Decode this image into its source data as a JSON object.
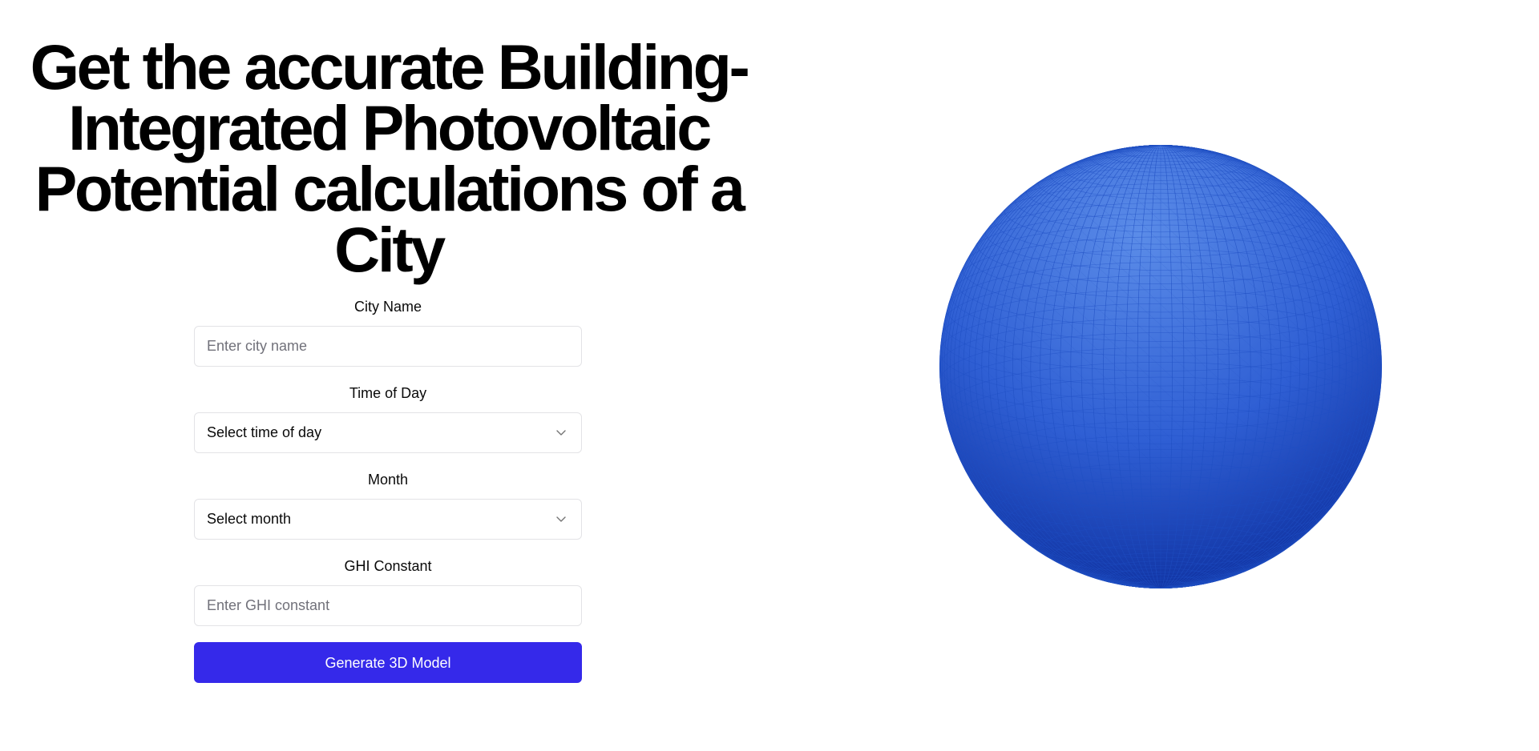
{
  "hero": {
    "title_lines": [
      "Get the accurate Building-",
      "Integrated Photovoltaic",
      "Potential calculations of a",
      "City"
    ]
  },
  "form": {
    "city": {
      "label": "City Name",
      "placeholder": "Enter city name",
      "value": ""
    },
    "time_of_day": {
      "label": "Time of Day",
      "selected": "Select time of day"
    },
    "month": {
      "label": "Month",
      "selected": "Select month"
    },
    "ghi": {
      "label": "GHI Constant",
      "placeholder": "Enter GHI constant",
      "value": ""
    },
    "submit_label": "Generate 3D Model"
  },
  "viewer": {
    "object": "wireframe-sphere",
    "colors": {
      "top": "#5b8ce8",
      "mid": "#2f5fd4",
      "bottom": "#0d2f9e",
      "wire": "#1f4fc4"
    }
  },
  "colors": {
    "accent": "#3529ea",
    "border": "#e3e3e6",
    "placeholder": "#71717a"
  }
}
